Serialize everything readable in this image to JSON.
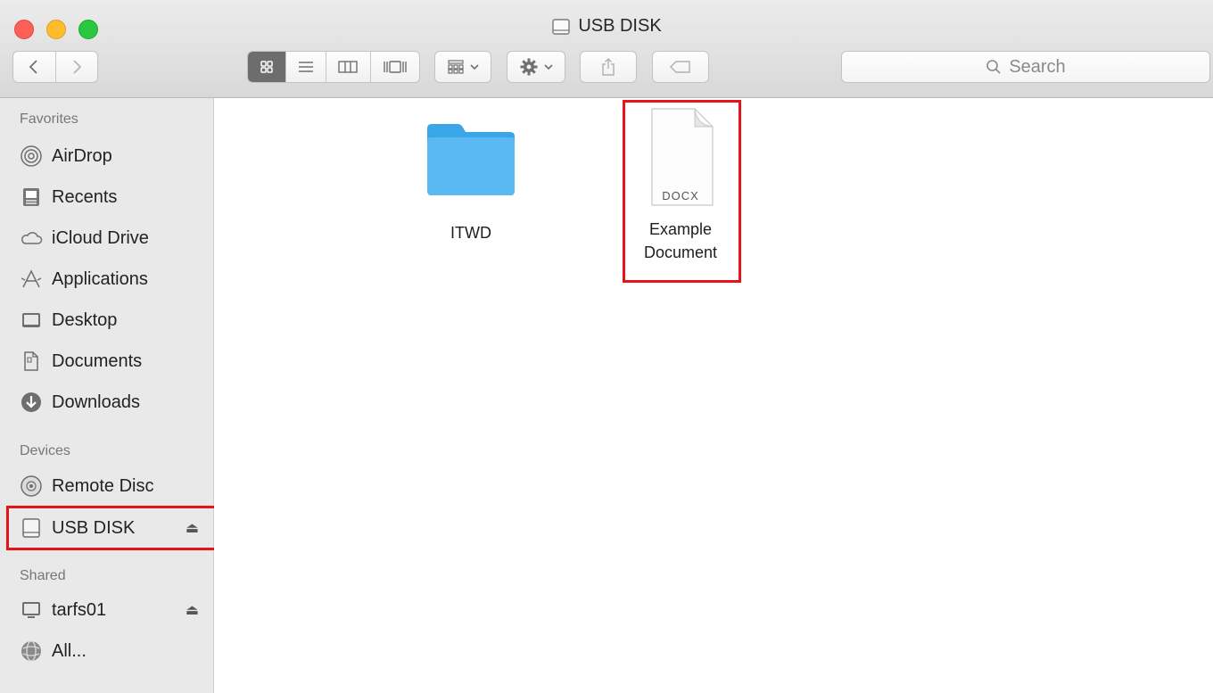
{
  "window": {
    "title": "USB DISK",
    "traffic": {
      "close_color": "#fc5f57",
      "minimize_color": "#fdbc2e",
      "zoom_color": "#2ac840"
    }
  },
  "toolbar": {
    "back_icon": "chevron-left-icon",
    "forward_icon": "chevron-right-icon",
    "view_modes": [
      "icon-view-icon",
      "list-view-icon",
      "column-view-icon",
      "cover-flow-icon"
    ],
    "active_view": "icon-view-icon",
    "arrange_icon": "arrange-grid-icon",
    "action_icon": "gear-icon",
    "share_icon": "share-icon",
    "tag_icon": "tag-icon",
    "search_placeholder": "Search"
  },
  "sidebar": {
    "favorites_header": "Favorites",
    "favorites": [
      {
        "label": "AirDrop",
        "icon": "airdrop-icon"
      },
      {
        "label": "Recents",
        "icon": "recents-icon"
      },
      {
        "label": "iCloud Drive",
        "icon": "cloud-icon"
      },
      {
        "label": "Applications",
        "icon": "applications-icon"
      },
      {
        "label": "Desktop",
        "icon": "desktop-icon"
      },
      {
        "label": "Documents",
        "icon": "documents-icon"
      },
      {
        "label": "Downloads",
        "icon": "downloads-icon"
      }
    ],
    "devices_header": "Devices",
    "devices": [
      {
        "label": "Remote Disc",
        "icon": "disc-icon"
      },
      {
        "label": "USB DISK",
        "icon": "drive-icon",
        "eject": "⏏"
      }
    ],
    "shared_header": "Shared",
    "shared": [
      {
        "label": "tarfs01",
        "icon": "computer-icon",
        "eject": "⏏"
      },
      {
        "label": "All...",
        "icon": "network-icon"
      }
    ]
  },
  "files": [
    {
      "name": "ITWD",
      "type": "folder",
      "icon": "folder-icon"
    },
    {
      "name_line1": "Example",
      "name_line2": "Document",
      "type": "docx",
      "badge": "DOCX",
      "icon": "document-icon"
    }
  ],
  "colors": {
    "highlight": "#e8121a",
    "folder": "#5ab8f2"
  }
}
